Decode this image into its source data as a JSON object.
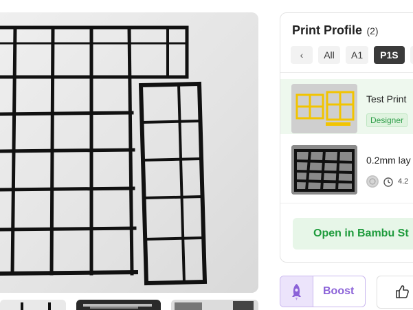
{
  "gallery": {
    "main_image": "3d printed black grid organizer on white surface"
  },
  "print_profile": {
    "title": "Print Profile",
    "count": "(2)",
    "tabs": [
      {
        "label": "All",
        "active": false
      },
      {
        "label": "A1",
        "active": false
      },
      {
        "label": "P1S",
        "active": true
      }
    ],
    "profiles": [
      {
        "name": "Test Print",
        "badge": "Designer"
      },
      {
        "name": "0.2mm lay",
        "time": "4.2"
      }
    ],
    "open_button": "Open in Bambu St"
  },
  "actions": {
    "boost_label": "Boost"
  },
  "colors": {
    "accent_green": "#1e9b3c",
    "boost_purple": "#8b62d8"
  }
}
